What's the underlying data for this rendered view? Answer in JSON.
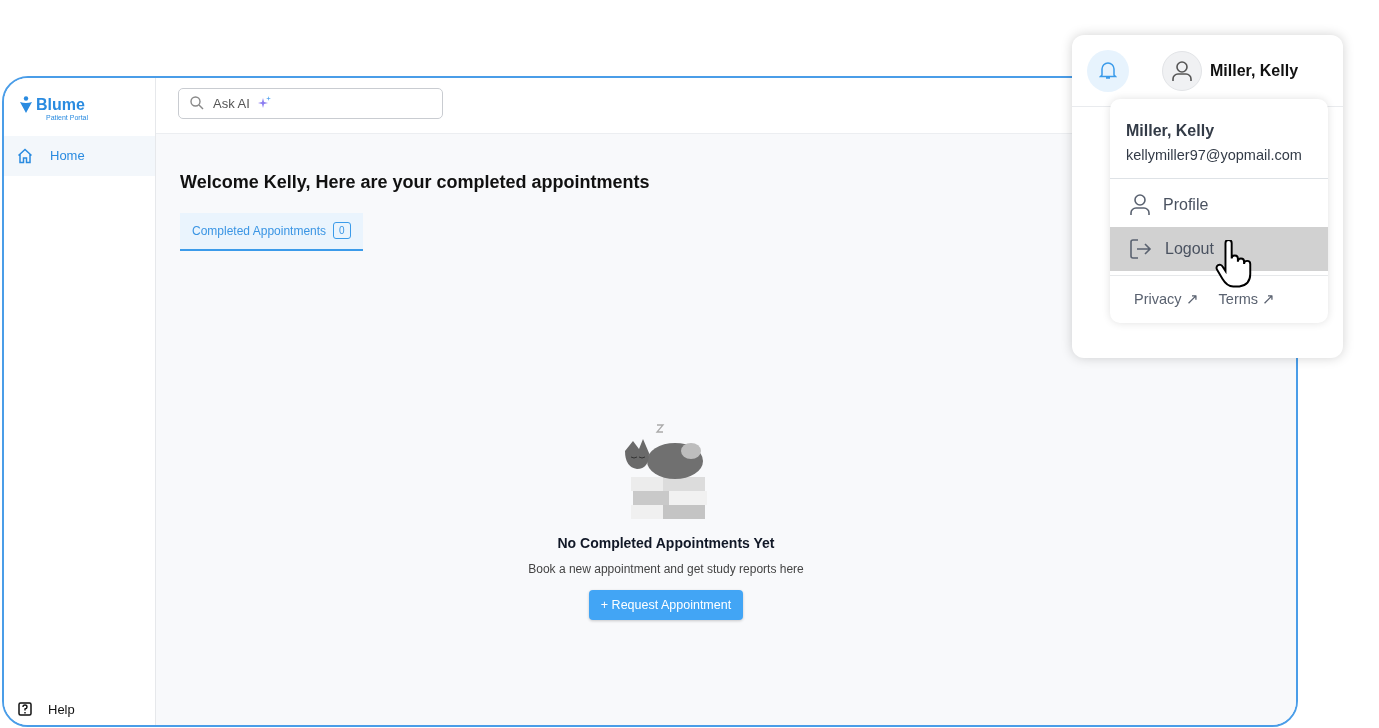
{
  "brand": {
    "name": "Blume",
    "subtitle": "Patient Portal"
  },
  "sidebar": {
    "items": [
      {
        "label": "Home",
        "selected": true
      }
    ],
    "footer": {
      "label": "Help"
    }
  },
  "search": {
    "placeholder": "Ask AI"
  },
  "heading": "Welcome Kelly, Here are your completed appointments",
  "tabs": [
    {
      "label": "Completed Appointments",
      "count": "0",
      "selected": true
    }
  ],
  "empty_state": {
    "title": "No Completed Appointments Yet",
    "text": "Book a new appointment and get study reports here",
    "button": "Request Appointment",
    "button_icon": "+"
  },
  "user_panel": {
    "name": "Miller, Kelly",
    "menu": {
      "name": "Miller, Kelly",
      "email": "kellymiller97@yopmail.com",
      "items": [
        {
          "kind": "profile",
          "label": "Profile",
          "hovered": false
        },
        {
          "kind": "logout",
          "label": "Logout",
          "hovered": true
        }
      ],
      "links": [
        {
          "label": "Privacy",
          "arrow": "↗"
        },
        {
          "label": "Terms",
          "arrow": "↗"
        }
      ]
    }
  }
}
